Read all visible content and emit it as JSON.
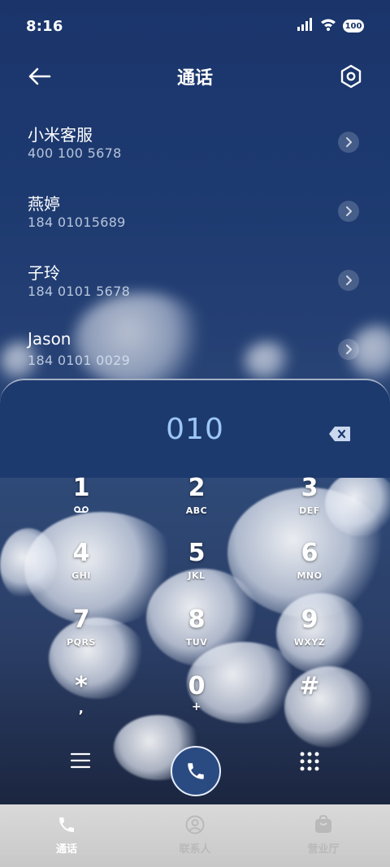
{
  "status_bar": {
    "time": "8:16",
    "battery": "100",
    "icons": [
      "signal-icon",
      "wifi-icon",
      "battery-icon"
    ]
  },
  "header": {
    "title": "通话",
    "back_icon": "back-arrow-icon",
    "settings_icon": "settings-icon"
  },
  "contacts": [
    {
      "name": "小米客服",
      "number": "400 100 5678"
    },
    {
      "name": "燕婷",
      "number": "184 01015689"
    },
    {
      "name": "子玲",
      "number": "184 0101 5678"
    },
    {
      "name": "Jason",
      "number": "184 0101 0029"
    }
  ],
  "dialer": {
    "dialed_number": "010",
    "keys": [
      {
        "digit": "1",
        "letters": "voicemail"
      },
      {
        "digit": "2",
        "letters": "ABC"
      },
      {
        "digit": "3",
        "letters": "DEF"
      },
      {
        "digit": "4",
        "letters": "GHI"
      },
      {
        "digit": "5",
        "letters": "JKL"
      },
      {
        "digit": "6",
        "letters": "MNO"
      },
      {
        "digit": "7",
        "letters": "PQRS"
      },
      {
        "digit": "8",
        "letters": "TUV"
      },
      {
        "digit": "9",
        "letters": "WXYZ"
      },
      {
        "digit": "*",
        "letters": ","
      },
      {
        "digit": "0",
        "letters": "+"
      },
      {
        "digit": "#",
        "letters": ""
      }
    ]
  },
  "tabs": [
    {
      "label": "通话",
      "icon": "phone-icon",
      "active": true
    },
    {
      "label": "联系人",
      "icon": "contact-icon",
      "active": false
    },
    {
      "label": "营业厅",
      "icon": "store-icon",
      "active": false
    }
  ],
  "colors": {
    "accent_dial_text": "#9cc7f4",
    "panel": "#1d3a6f",
    "tabbar": "#d0d0d0"
  }
}
